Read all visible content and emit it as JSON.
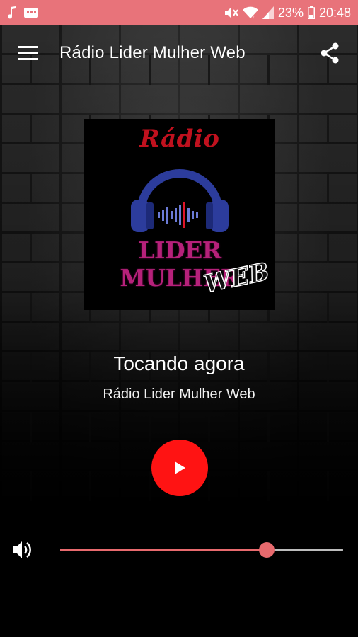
{
  "status_bar": {
    "battery": "23%",
    "time": "20:48",
    "icons": [
      "music-note-icon",
      "sd-card-icon",
      "mute-icon",
      "wifi-icon",
      "signal-icon",
      "battery-icon"
    ]
  },
  "app_bar": {
    "title": "Rádio Lider Mulher Web",
    "menu_icon": "hamburger-menu-icon",
    "share_icon": "share-icon"
  },
  "logo": {
    "top_text": "Rádio",
    "middle_text": "LIDER MULHER",
    "bottom_text": "WEB"
  },
  "player": {
    "now_playing_label": "Tocando agora",
    "station_name": "Rádio Lider Mulher Web",
    "play_icon": "play-icon",
    "volume_icon": "volume-icon",
    "volume_level": 0.73
  },
  "colors": {
    "status_bar": "#e8737a",
    "accent": "#e86a6e",
    "play_button": "#ff1313",
    "logo_red": "#c0111e",
    "logo_magenta": "#b6217a",
    "headphones_blue": "#2c3c9c"
  }
}
